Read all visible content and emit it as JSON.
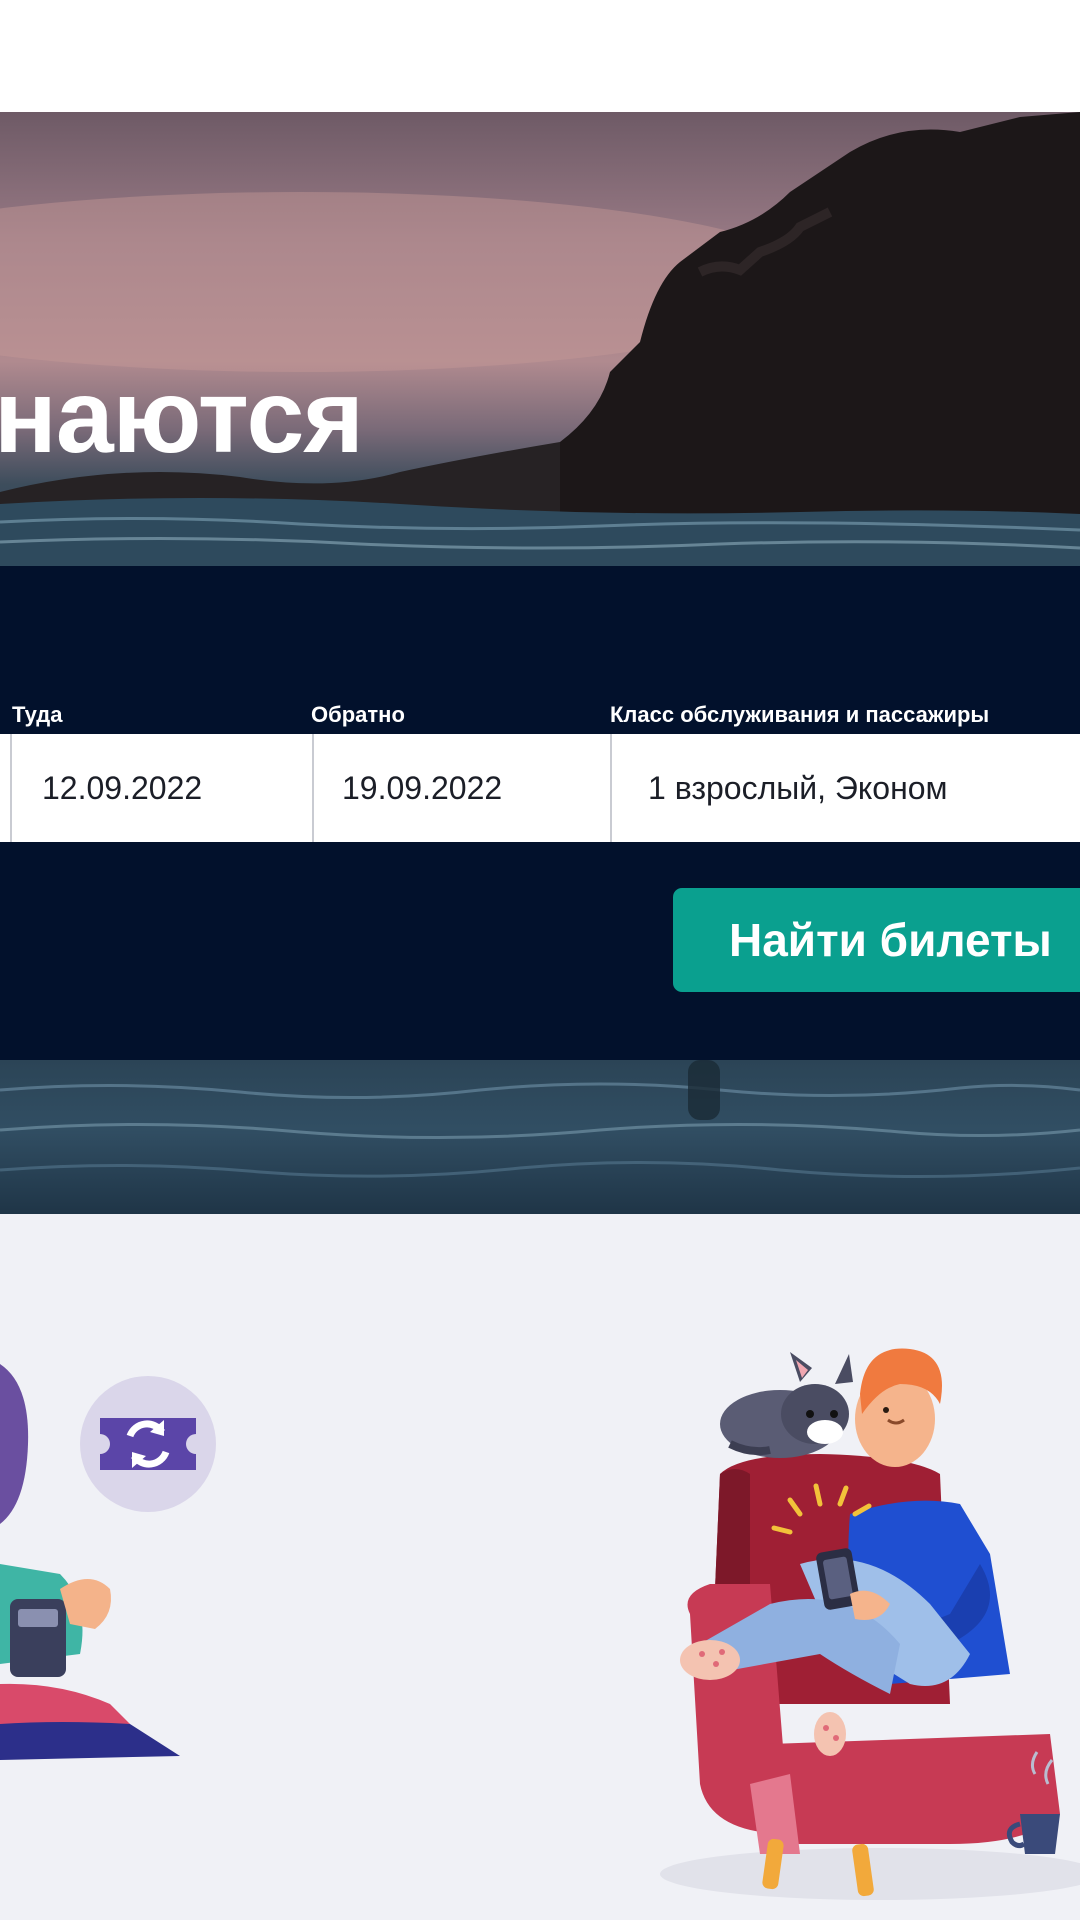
{
  "hero": {
    "title": "наются"
  },
  "search": {
    "fields": [
      {
        "label": "Туда",
        "value": "12.09.2022"
      },
      {
        "label": "Обратно",
        "value": "19.09.2022"
      },
      {
        "label": "Класс обслуживания и пассажиры",
        "value": "1 взрослый, Эконом"
      }
    ],
    "submit_label": "Найти билеты"
  },
  "icons": [
    "ticket-exchange-icon"
  ],
  "colors": {
    "panel_bg": "#02112c",
    "button_bg": "#0aa08f",
    "lower_bg": "#f0f1f6"
  }
}
